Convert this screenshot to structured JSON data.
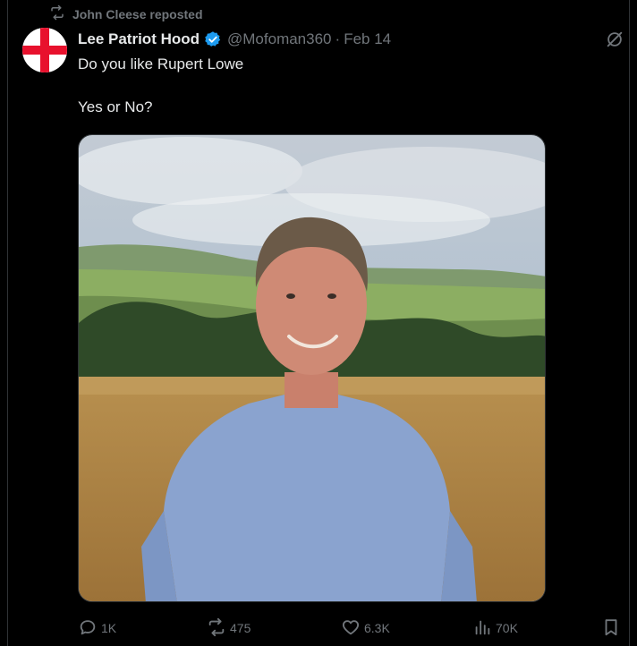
{
  "repost": {
    "label": "John Cleese reposted"
  },
  "author": {
    "display_name": "Lee Patriot Hood",
    "handle": "@Mofoman360",
    "separator": "·",
    "date": "Feb 14"
  },
  "tweet": {
    "text": "Do you like Rupert Lowe\n\nYes or No?"
  },
  "actions": {
    "replies": "1K",
    "reposts": "475",
    "likes": "6.3K",
    "views": "70K"
  },
  "colors": {
    "accent_verified": "#1d9bf0",
    "muted": "#71767b",
    "text": "#e7e9ea",
    "background": "#000000",
    "cross_red": "#e8112d"
  },
  "icons": [
    "repost-icon",
    "verified-badge-icon",
    "grok-icon",
    "reply-icon",
    "repost-icon",
    "like-icon",
    "views-icon",
    "bookmark-icon"
  ]
}
